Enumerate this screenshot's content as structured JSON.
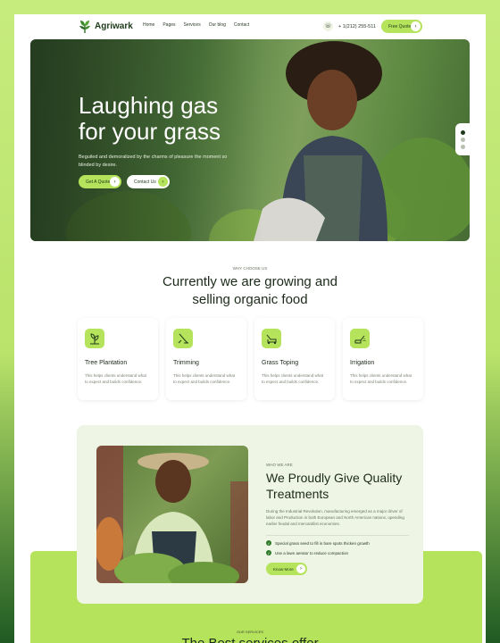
{
  "brand": {
    "name": "Agriwark"
  },
  "nav": {
    "items": [
      "Home",
      "Pages",
      "Services",
      "Our blog",
      "Contact"
    ],
    "phone": "+ 1(212) 255-511",
    "cta": "Free Quote"
  },
  "hero": {
    "title_line1": "Laughing gas",
    "title_line2": "for your grass",
    "subtitle": "Beguiled and demoralized by the charms of pleasure the moment so blinded by desire.",
    "btn_primary": "Get A Quote",
    "btn_secondary": "Contact Us"
  },
  "services": {
    "kicker": "WHY CHOOSE US",
    "title_line1": "Currently we are growing and",
    "title_line2": "selling organic food",
    "cards": [
      {
        "title": "Tree Plantation",
        "desc": "This helps clients understand what to expect and builds confidence.",
        "icon": "plant-icon"
      },
      {
        "title": "Trimming",
        "desc": "This helps clients understand what to expect and builds confidence.",
        "icon": "trimmer-icon"
      },
      {
        "title": "Grass Toping",
        "desc": "This helps clients understand what to expect and builds confidence.",
        "icon": "mower-icon"
      },
      {
        "title": "Irrigation",
        "desc": "This helps clients understand what to expect and builds confidence.",
        "icon": "watering-icon"
      }
    ]
  },
  "about": {
    "kicker": "WHO WE ARE",
    "title_line1": "We Proudly Give Quality",
    "title_line2": "Treatments",
    "desc": "During the Industrial Revolution, manufacturing emerged as a major driver of labor and Production in both European and North American nations, upending earlier feudal and mercantilist economies.",
    "checks": [
      "Special grass seed to fill in bare spots thicken growth",
      "Use a lawn aerator to reduce compaction"
    ],
    "button": "Know More"
  },
  "bottom": {
    "kicker": "OUR SERVICES",
    "title": "The Best services offer"
  },
  "colors": {
    "accent": "#b5e35b",
    "dark": "#1e3a1b"
  }
}
